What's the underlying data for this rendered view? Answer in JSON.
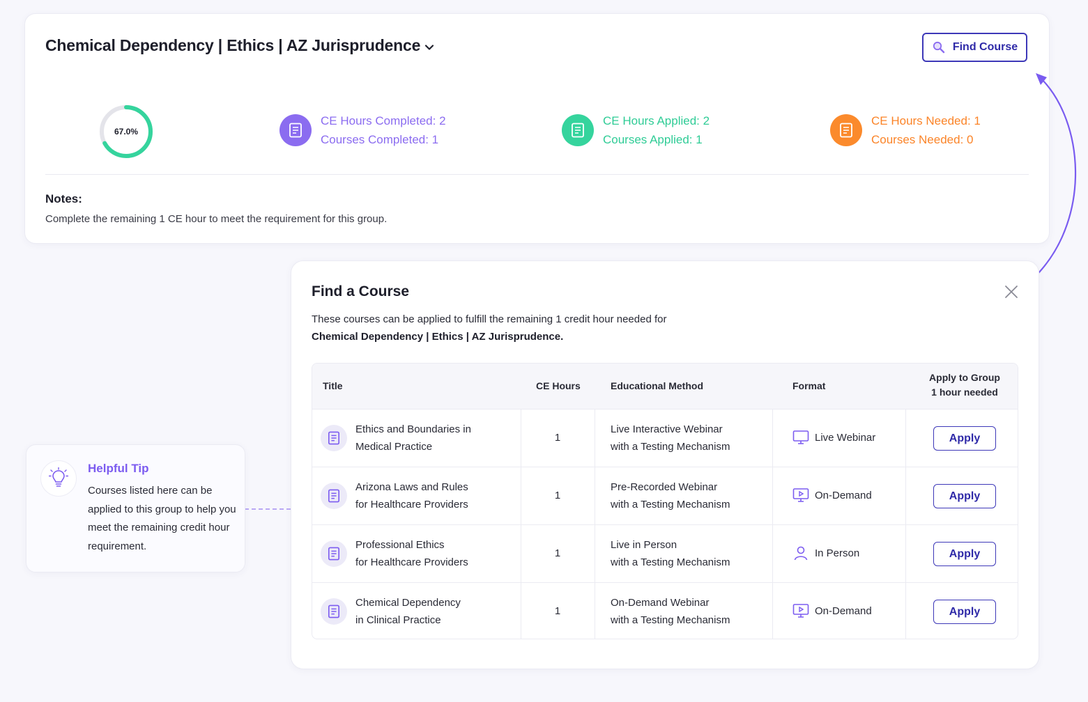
{
  "requirement": {
    "title": "Chemical Dependency | Ethics | AZ Jurisprudence",
    "find_button_label": "Find Course",
    "progress_text": "67.0%",
    "progress_fraction": 0.67,
    "stats": {
      "completed": {
        "hours": "CE Hours Completed: 2",
        "courses": "Courses Completed: 1",
        "color": "#8b6cf0"
      },
      "applied": {
        "hours": "CE Hours Applied: 2",
        "courses": "Courses Applied: 1",
        "color": "#35d49d"
      },
      "needed": {
        "hours": "CE Hours Needed: 1",
        "courses": "Courses Needed: 0",
        "color": "#fb8a2c"
      }
    },
    "notes_label": "Notes:",
    "notes_text": "Complete the remaining 1 CE hour to meet the requirement for this group."
  },
  "find_course": {
    "title": "Find a Course",
    "description": "These courses can be applied to fulfill the remaining 1 credit hour needed for",
    "group_name": "Chemical Dependency | Ethics | AZ Jurisprudence.",
    "columns": {
      "title": "Title",
      "hours": "CE Hours",
      "method": "Educational Method",
      "format": "Format",
      "apply_line1": "Apply to Group",
      "apply_line2": "1 hour needed"
    },
    "rows": [
      {
        "title1": "Ethics and Boundaries in",
        "title2": "Medical Practice",
        "hours": "1",
        "method1": "Live Interactive Webinar",
        "method2": "with a Testing Mechanism",
        "format": "Live Webinar",
        "format_icon": "monitor-icon",
        "apply": "Apply"
      },
      {
        "title1": "Arizona Laws and Rules",
        "title2": "for Healthcare Providers",
        "hours": "1",
        "method1": "Pre-Recorded Webinar",
        "method2": "with a Testing Mechanism",
        "format": "On-Demand",
        "format_icon": "play-screen-icon",
        "apply": "Apply"
      },
      {
        "title1": "Professional Ethics",
        "title2": "for Healthcare Providers",
        "hours": "1",
        "method1": "Live in Person",
        "method2": "with a Testing Mechanism",
        "format": "In Person",
        "format_icon": "person-icon",
        "apply": "Apply"
      },
      {
        "title1": "Chemical Dependency",
        "title2": "in Clinical Practice",
        "hours": "1",
        "method1": "On-Demand Webinar",
        "method2": "with a Testing Mechanism",
        "format": "On-Demand",
        "format_icon": "play-screen-icon",
        "apply": "Apply"
      }
    ]
  },
  "tip": {
    "title": "Helpful Tip",
    "text": "Courses listed here can be applied to this group to help you meet the remaining credit hour requirement."
  },
  "colors": {
    "accent": "#3d38b8",
    "purple": "#7c5cf0",
    "green": "#35d49d",
    "orange": "#fb8a2c"
  }
}
